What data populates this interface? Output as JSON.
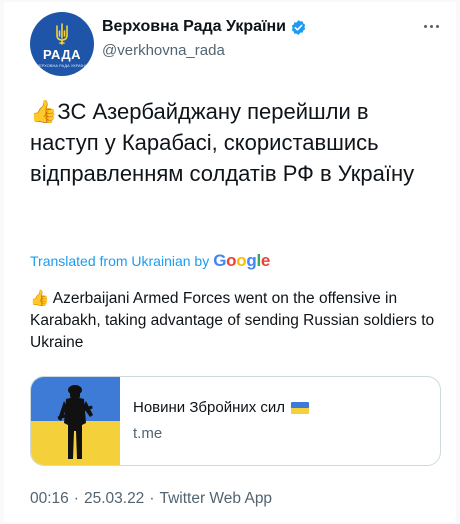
{
  "author": {
    "display_name": "Верховна Рада України",
    "handle": "@verkhovna_rada",
    "avatar_abbr": "РАДА",
    "avatar_tiny": "ВЕРХОВНА РАДА УКРАЇНИ",
    "verified_icon": "verified-badge-icon"
  },
  "tweet": {
    "emoji": "👍",
    "text": "ЗС Азербайджану перейшли в наступ у Карабасі, скориставшись відправленням солдатів РФ в Україну"
  },
  "translation": {
    "label": "Translated from Ukrainian by",
    "provider": {
      "p1": "G",
      "p2": "o",
      "p3": "o",
      "p4": "g",
      "p5": "l",
      "p6": "e"
    },
    "emoji": "👍",
    "text": "Azerbaijani Armed Forces went on the offensive in Karabakh, taking advantage of sending Russian soldiers to Ukraine"
  },
  "link_card": {
    "title": "Новини Збройних сил",
    "domain": "t.me",
    "thumb_icon": "soldier-flag-icon",
    "flag_icon": "ukraine-flag-icon"
  },
  "meta": {
    "time": "00:16",
    "dot1": "·",
    "date": "25.03.22",
    "dot2": "·",
    "app": "Twitter Web App"
  },
  "colors": {
    "accent": "#1d9bf0",
    "avatar_bg": "#1f55a8",
    "flag_blue": "#3d7bd6",
    "flag_yellow": "#f4d03a"
  }
}
